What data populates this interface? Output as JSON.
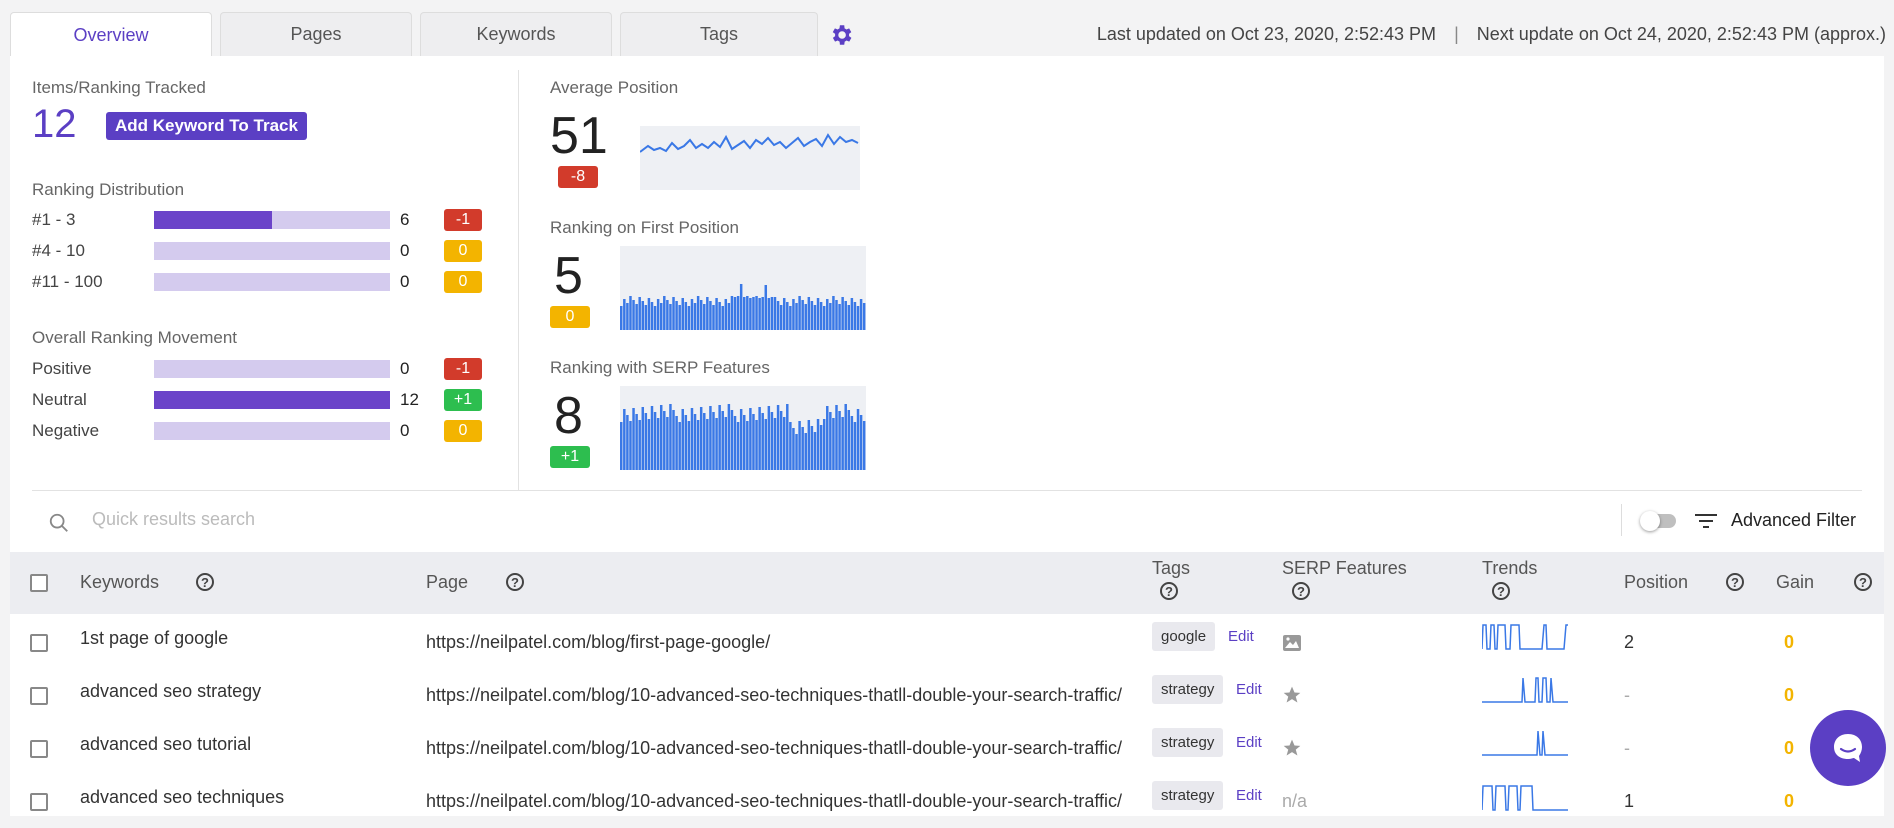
{
  "tabs": [
    {
      "label": "Overview",
      "active": true
    },
    {
      "label": "Pages",
      "active": false
    },
    {
      "label": "Keywords",
      "active": false
    },
    {
      "label": "Tags",
      "active": false
    }
  ],
  "header": {
    "last_updated": "Last updated on Oct 23, 2020, 2:52:43 PM",
    "separator": "|",
    "next_update": "Next update on Oct 24, 2020, 2:52:43 PM (approx.)"
  },
  "summary": {
    "tracked_label": "Items/Ranking Tracked",
    "tracked_count": "12",
    "add_button": "Add Keyword To Track",
    "distribution_label": "Ranking Distribution",
    "distribution": [
      {
        "name": "#1 - 3",
        "count": "6",
        "fill": 0.5,
        "delta": "-1",
        "delta_color": "#d23b2b"
      },
      {
        "name": "#4 - 10",
        "count": "0",
        "fill": 0,
        "delta": "0",
        "delta_color": "#f3b400"
      },
      {
        "name": "#11 - 100",
        "count": "0",
        "fill": 0,
        "delta": "0",
        "delta_color": "#f3b400"
      }
    ],
    "movement_label": "Overall Ranking Movement",
    "movement": [
      {
        "name": "Positive",
        "count": "0",
        "fill": 0,
        "delta": "-1",
        "delta_color": "#d23b2b"
      },
      {
        "name": "Neutral",
        "count": "12",
        "fill": 1,
        "delta": "+1",
        "delta_color": "#2dbe4f"
      },
      {
        "name": "Negative",
        "count": "0",
        "fill": 0,
        "delta": "0",
        "delta_color": "#f3b400"
      }
    ]
  },
  "metrics": [
    {
      "label": "Average Position",
      "value": "51",
      "delta": "-8",
      "delta_color": "#d23b2b",
      "chart": "line"
    },
    {
      "label": "Ranking on First Position",
      "value": "5",
      "delta": "0",
      "delta_color": "#f3b400",
      "chart": "bars"
    },
    {
      "label": "Ranking with SERP Features",
      "value": "8",
      "delta": "+1",
      "delta_color": "#2dbe4f",
      "chart": "bars"
    }
  ],
  "search": {
    "placeholder": "Quick results search"
  },
  "filter": {
    "label": "Advanced Filter"
  },
  "table": {
    "columns": {
      "keywords": "Keywords",
      "page": "Page",
      "tags": "Tags",
      "serp": "SERP Features",
      "trends": "Trends",
      "position": "Position",
      "gain": "Gain"
    },
    "rows": [
      {
        "keyword": "1st page of google",
        "page": "https://neilpatel.com/blog/first-page-google/",
        "tag": "google",
        "edit": "Edit",
        "serp_icon": "image-icon",
        "position": "2",
        "gain": "0"
      },
      {
        "keyword": "advanced seo strategy",
        "page": "https://neilpatel.com/blog/10-advanced-seo-techniques-thatll-double-your-search-traffic/",
        "tag": "strategy",
        "edit": "Edit",
        "serp_icon": "star-icon",
        "position": "-",
        "gain": "0"
      },
      {
        "keyword": "advanced seo tutorial",
        "page": "https://neilpatel.com/blog/10-advanced-seo-techniques-thatll-double-your-search-traffic/",
        "tag": "strategy",
        "edit": "Edit",
        "serp_icon": "star-icon",
        "position": "-",
        "gain": "0"
      },
      {
        "keyword": "advanced seo techniques",
        "page": "https://neilpatel.com/blog/10-advanced-seo-techniques-thatll-double-your-search-traffic/",
        "tag": "strategy",
        "edit": "Edit",
        "serp_text": "n/a",
        "position": "1",
        "gain": "0"
      }
    ]
  },
  "colors": {
    "accent": "#5b3fc4",
    "chart_blue": "#3a78e6"
  }
}
